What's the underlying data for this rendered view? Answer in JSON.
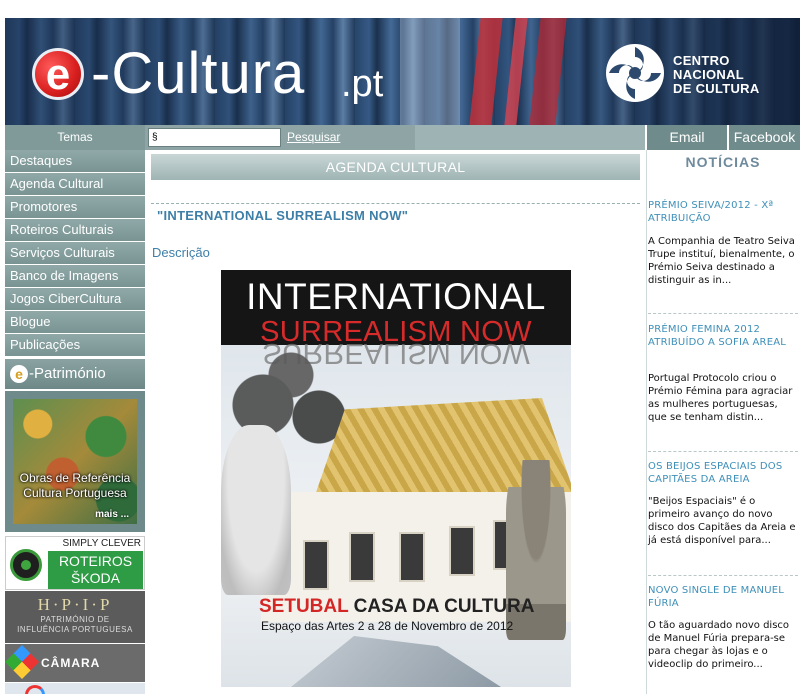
{
  "header": {
    "logo_letter": "e",
    "logo_main": "-Cultura",
    "logo_tld": ".pt",
    "cnc_line1": "CENTRO",
    "cnc_line2": "NACIONAL",
    "cnc_line3": "DE CULTURA"
  },
  "nav": {
    "temas": "Temas",
    "search_value": "§",
    "search_link": "Pesquisar",
    "email": "Email",
    "facebook": "Facebook"
  },
  "sidebar": {
    "items": [
      {
        "label": "Destaques"
      },
      {
        "label": "Agenda Cultural"
      },
      {
        "label": "Promotores"
      },
      {
        "label": "Roteiros Culturais"
      },
      {
        "label": "Serviços Culturais"
      },
      {
        "label": "Banco de Imagens"
      },
      {
        "label": "Jogos CiberCultura"
      },
      {
        "label": "Blogue"
      },
      {
        "label": "Publicações"
      }
    ],
    "patrimonio_letter": "e",
    "patrimonio_label": "-Património",
    "obras_line1": "Obras de Referência",
    "obras_line2": "Cultura Portuguesa",
    "obras_mais": "mais ...",
    "skoda_simply": "SIMPLY CLEVER",
    "skoda_line1": "ROTEIROS",
    "skoda_line2": "ŠKODA",
    "hpip_title": "H·P·I·P",
    "hpip_sub1": "PATRIMÓNIO DE",
    "hpip_sub2": "INFLUÊNCIA PORTUGUESA",
    "camara_label": "CÂMARA CLARA"
  },
  "main": {
    "section_title": "AGENDA CULTURAL",
    "event_title": "\"INTERNATIONAL SURREALISM NOW\"",
    "description_label": "Descrição",
    "poster": {
      "line1": "INTERNATIONAL",
      "line2": "SURREALISM NOW",
      "mirror": "SURREALISM NOW",
      "venue_red": "SETUBAL",
      "venue_rest": " CASA DA CULTURA",
      "dates": "Espaço das Artes  2 a 28 de Novembro de 2012"
    }
  },
  "news": {
    "heading": "NOTÍCIAS",
    "items": [
      {
        "title": "PRÉMIO SEIVA/2012 - Xª ATRIBUIÇÃO",
        "body": "A Companhia de Teatro Seiva Trupe instituí, bienalmente, o Prémio Seiva destinado a distinguir as in..."
      },
      {
        "title": "PRÉMIO FEMINA 2012 ATRIBUÍDO A SOFIA AREAL",
        "body": "Portugal Protocolo criou o Prémio Fémina para agraciar as mulheres portuguesas, que se tenham distin..."
      },
      {
        "title": "OS BEIJOS ESPACIAIS DOS CAPITÃES DA AREIA",
        "body": "\"Beijos Espaciais\" é o primeiro avanço do novo disco dos Capitães da Areia e já está disponível para..."
      },
      {
        "title": "NOVO SINGLE DE MANUEL FÚRIA",
        "body": "O tão aguardado novo disco de Manuel Fúria prepara-se para chegar às lojas e o videoclip do primeiro..."
      }
    ]
  }
}
